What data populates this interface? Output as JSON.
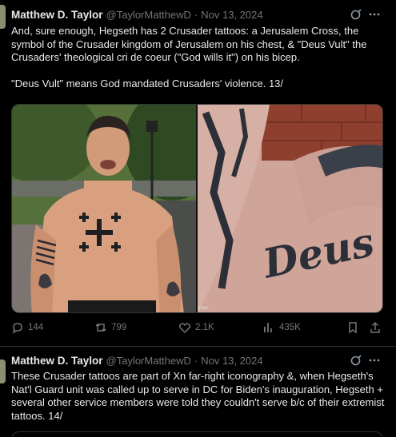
{
  "tweets": [
    {
      "author_name": "Matthew D. Taylor",
      "handle": "@TaylorMatthewD",
      "date": "Nov 13, 2024",
      "text": "And, sure enough, Hegseth has 2 Crusader tattoos: a Jerusalem Cross, the symbol of the Crusader kingdom of Jerusalem on his chest, & \"Deus Vult\" the Crusaders' theological cri de coeur (\"God wills it\") on his bicep.\n\n\"Deus Vult\" means God mandated Crusaders' violence. 13/",
      "media": {
        "right_tattoo_text": "Deus Vult",
        "watermark": "gram"
      },
      "stats": {
        "replies": "144",
        "reposts": "799",
        "likes": "2.1K",
        "views": "435K"
      }
    },
    {
      "author_name": "Matthew D. Taylor",
      "handle": "@TaylorMatthewD",
      "date": "Nov 13, 2024",
      "text": "These Crusader tattoos are part of Xn far-right iconography &, when Hegseth's Nat'l Guard unit was called up to serve in DC for Biden's inauguration, Hegseth + several other service members were told they couldn't serve b/c of their extremist tattoos. 14/"
    }
  ],
  "icons": [
    "grok-icon",
    "more-icon",
    "reply-icon",
    "repost-icon",
    "like-icon",
    "views-icon",
    "bookmark-icon",
    "share-icon"
  ],
  "colors": {
    "background": "#000000",
    "text": "#e7e9ea",
    "muted": "#71767b",
    "divider": "#2f3336"
  }
}
